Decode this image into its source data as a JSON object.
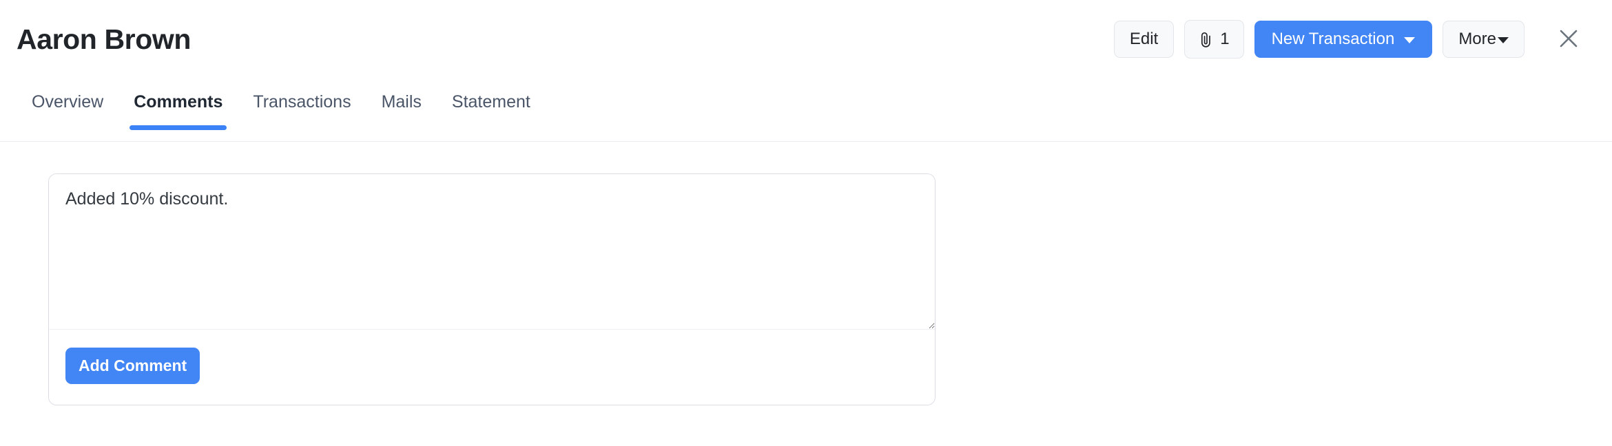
{
  "header": {
    "title": "Aaron Brown",
    "actions": {
      "edit_label": "Edit",
      "attachment_icon": "paperclip-icon",
      "attachment_count": "1",
      "new_transaction_label": "New Transaction",
      "more_label": "More",
      "close_icon": "close-icon"
    }
  },
  "tabs": [
    {
      "label": "Overview",
      "active": false
    },
    {
      "label": "Comments",
      "active": true
    },
    {
      "label": "Transactions",
      "active": false
    },
    {
      "label": "Mails",
      "active": false
    },
    {
      "label": "Statement",
      "active": false
    }
  ],
  "main": {
    "comment_box": {
      "value": "Added 10% discount.",
      "placeholder": "",
      "submit_label": "Add Comment"
    }
  },
  "colors": {
    "primary": "#4285f4",
    "tab_active_indicator": "#3b82f6",
    "border": "#dcdce6",
    "text": "#212529",
    "muted_text": "#4a5568"
  }
}
